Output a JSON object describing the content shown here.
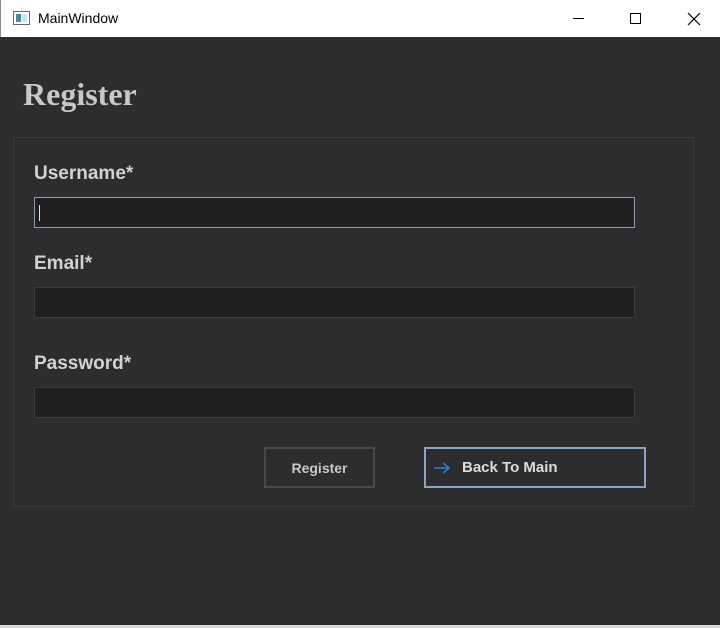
{
  "window": {
    "title": "MainWindow",
    "controls": {
      "minimize": "minimize",
      "maximize": "maximize",
      "close": "close"
    }
  },
  "page": {
    "heading": "Register"
  },
  "form": {
    "username": {
      "label": "Username*",
      "value": "",
      "placeholder": ""
    },
    "email": {
      "label": "Email*",
      "value": "",
      "placeholder": ""
    },
    "password": {
      "label": "Password*",
      "value": "",
      "placeholder": ""
    }
  },
  "buttons": {
    "register_label": "Register",
    "back_label": "Back To Main"
  },
  "icons": {
    "app": "app-window-icon",
    "back": "arrow-right-icon"
  },
  "colors": {
    "background": "#2d2c2e",
    "field_bg": "#1f1e20",
    "focus_border": "#8e9bb0",
    "accent_arrow": "#2b7fd0"
  }
}
